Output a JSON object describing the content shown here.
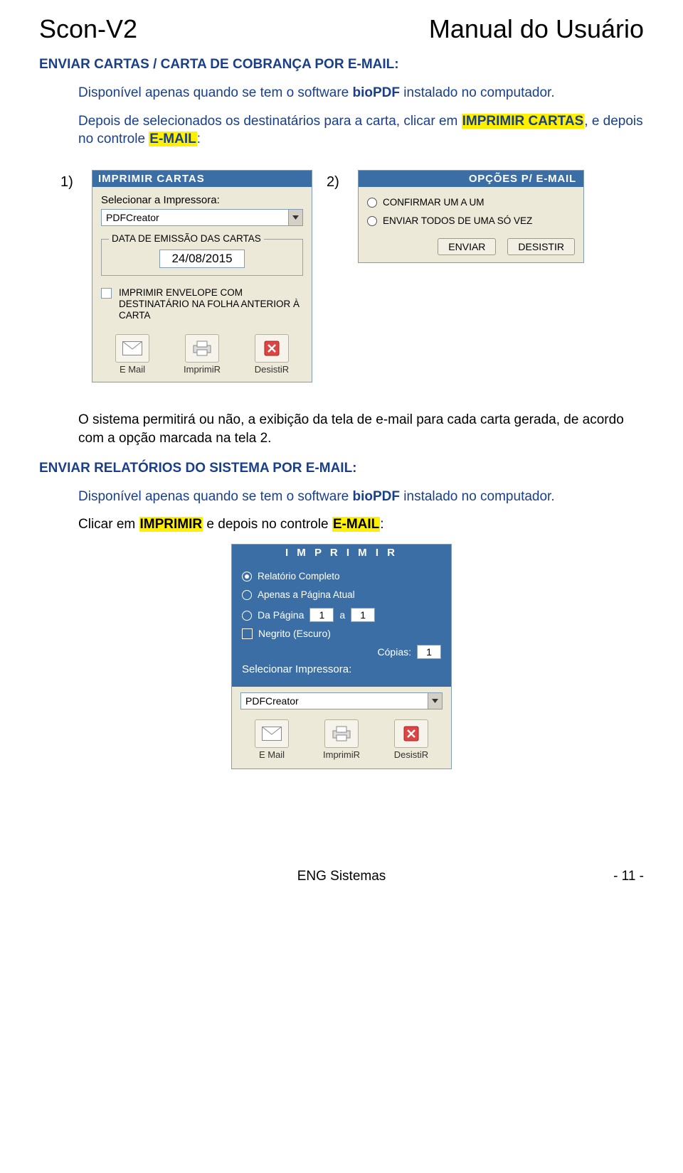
{
  "header": {
    "left": "Scon-V2",
    "right": "Manual do Usuário"
  },
  "section1": {
    "title": "ENVIAR CARTAS / CARTA DE COBRANÇA POR E-MAIL:",
    "para1_full": "Disponível apenas quando se tem o software bioPDF instalado no computador.",
    "para1_a": "Disponível apenas quando se tem o software ",
    "para1_b": "bioPDF",
    "para1_c": " instalado no computador.",
    "para2_a": "Depois de selecionados os destinatários para a carta, clicar em ",
    "para2_hl1": "IMPRIMIR CARTAS",
    "para2_b": ", e depois no controle ",
    "para2_hl2": "E-MAIL",
    "para2_c": ":"
  },
  "panel1": {
    "num": "1)",
    "title": "IMPRIMIR  CARTAS",
    "select_label": "Selecionar a Impressora:",
    "printer": "PDFCreator",
    "fieldset_legend": "DATA DE EMISSÃO DAS CARTAS",
    "date": "24/08/2015",
    "chk_label": "IMPRIMIR ENVELOPE COM DESTINATÁRIO NA FOLHA ANTERIOR À CARTA",
    "btn_email": "E Mail",
    "btn_print": "ImprimiR",
    "btn_cancel": "DesistiR"
  },
  "panel2": {
    "num": "2)",
    "title": "OPÇÕES P/ E-MAIL",
    "opt1": "CONFIRMAR UM A UM",
    "opt2": "ENVIAR TODOS DE UMA SÓ VEZ",
    "btn_send": "ENVIAR",
    "btn_cancel": "DESISTIR"
  },
  "section1_post": {
    "para3": "O sistema permitirá ou não, a exibição da tela de e-mail para cada carta gerada, de acordo com a opção marcada na tela 2."
  },
  "section2": {
    "title": "ENVIAR RELATÓRIOS DO SISTEMA POR E-MAIL:",
    "para1_a": "Disponível apenas quando se tem o software ",
    "para1_b": "bioPDF",
    "para1_c": " instalado no computador.",
    "para2_a": "Clicar em ",
    "para2_hl1": "IMPRIMIR",
    "para2_b": " e depois no controle ",
    "para2_hl2": "E-MAIL",
    "para2_c": ":"
  },
  "panel3": {
    "title": "I M P R I M I R",
    "opt1": "Relatório Completo",
    "opt2": "Apenas a Página Atual",
    "opt3": "Da Página",
    "page_from": "1",
    "a": "a",
    "page_to": "1",
    "negrito": "Negrito (Escuro)",
    "copies_label": "Cópias:",
    "copies": "1",
    "select_label": "Selecionar Impressora:",
    "printer": "PDFCreator",
    "btn_email": "E Mail",
    "btn_print": "ImprimiR",
    "btn_cancel": "DesistiR"
  },
  "footer": {
    "center": "ENG Sistemas",
    "page": "- 11 -"
  }
}
